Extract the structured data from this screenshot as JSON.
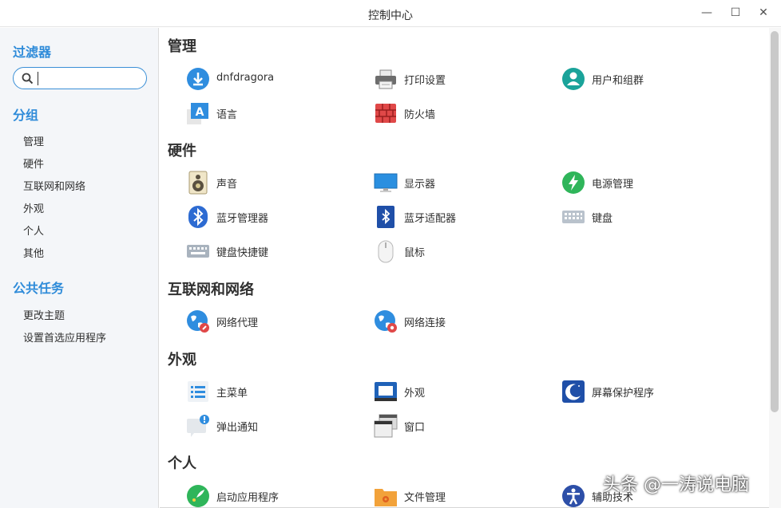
{
  "window": {
    "title": "控制中心",
    "min_glyph": "—",
    "max_glyph": "☐",
    "close_glyph": "✕"
  },
  "sidebar": {
    "filter_heading": "过滤器",
    "search": {
      "value": "",
      "placeholder": ""
    },
    "group_heading": "分组",
    "groups": [
      "管理",
      "硬件",
      "互联网和网络",
      "外观",
      "个人",
      "其他"
    ],
    "tasks_heading": "公共任务",
    "tasks": [
      "更改主题",
      "设置首选应用程序"
    ]
  },
  "sections": [
    {
      "title": "管理",
      "items": [
        {
          "label": "dnfdragora",
          "icon": "download-icon"
        },
        {
          "label": "打印设置",
          "icon": "printer-icon"
        },
        {
          "label": "用户和组群",
          "icon": "users-icon"
        },
        {
          "label": "语言",
          "icon": "language-icon"
        },
        {
          "label": "防火墙",
          "icon": "firewall-icon"
        }
      ]
    },
    {
      "title": "硬件",
      "items": [
        {
          "label": "声音",
          "icon": "speaker-icon"
        },
        {
          "label": "显示器",
          "icon": "monitor-icon"
        },
        {
          "label": "电源管理",
          "icon": "power-icon"
        },
        {
          "label": "蓝牙管理器",
          "icon": "bluetooth-icon"
        },
        {
          "label": "蓝牙适配器",
          "icon": "bluetooth-adapter-icon"
        },
        {
          "label": "键盘",
          "icon": "keyboard-icon"
        },
        {
          "label": "键盘快捷键",
          "icon": "keyboard-shortcuts-icon"
        },
        {
          "label": "鼠标",
          "icon": "mouse-icon"
        }
      ]
    },
    {
      "title": "互联网和网络",
      "items": [
        {
          "label": "网络代理",
          "icon": "network-proxy-icon"
        },
        {
          "label": "网络连接",
          "icon": "network-connections-icon"
        }
      ]
    },
    {
      "title": "外观",
      "items": [
        {
          "label": "主菜单",
          "icon": "main-menu-icon"
        },
        {
          "label": "外观",
          "icon": "appearance-icon"
        },
        {
          "label": "屏幕保护程序",
          "icon": "screensaver-icon"
        },
        {
          "label": "弹出通知",
          "icon": "notification-icon"
        },
        {
          "label": "窗口",
          "icon": "windows-icon"
        }
      ]
    },
    {
      "title": "个人",
      "items": [
        {
          "label": "启动应用程序",
          "icon": "startup-apps-icon"
        },
        {
          "label": "文件管理",
          "icon": "file-manager-icon"
        },
        {
          "label": "辅助技术",
          "icon": "accessibility-icon"
        }
      ]
    }
  ],
  "watermark": "头条 @一涛说电脑"
}
